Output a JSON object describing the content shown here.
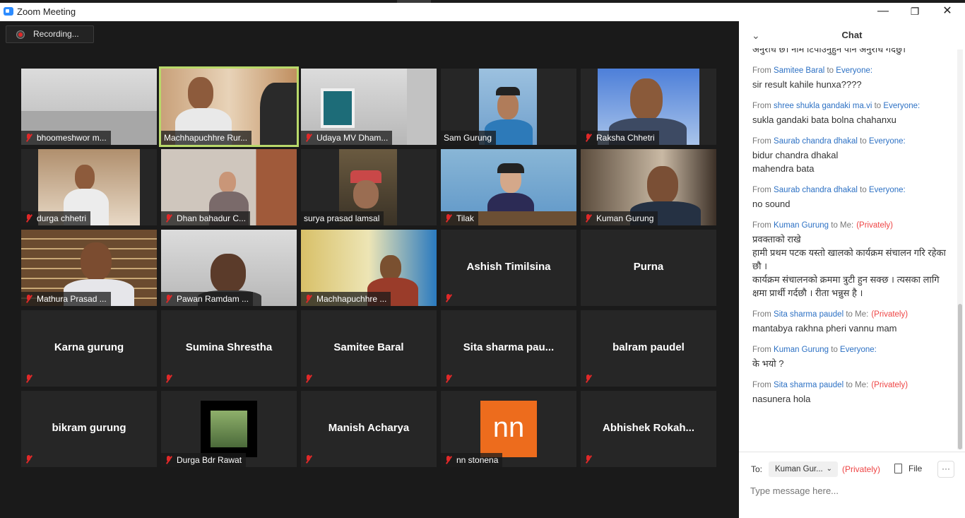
{
  "window": {
    "title": "Zoom Meeting",
    "controls": {
      "minimize": "—",
      "restore": "❐",
      "close": "✕"
    }
  },
  "meeting": {
    "recording_label": "Recording...",
    "tiles": [
      {
        "name": "bhoomeshwor m...",
        "type": "video"
      },
      {
        "name": "Machhapuchhre Rur...",
        "type": "video",
        "active": true
      },
      {
        "name": "Udaya MV Dham...",
        "type": "video"
      },
      {
        "name": "Sam Gurung",
        "type": "video"
      },
      {
        "name": "Raksha Chhetri",
        "type": "video"
      },
      {
        "name": "durga chhetri",
        "type": "video"
      },
      {
        "name": "Dhan bahadur C...",
        "type": "video"
      },
      {
        "name": "surya prasad lamsal",
        "type": "video"
      },
      {
        "name": "Tilak",
        "type": "video"
      },
      {
        "name": "Kuman Gurung",
        "type": "video"
      },
      {
        "name": "Mathura Prasad ...",
        "type": "video"
      },
      {
        "name": "Pawan Ramdam ...",
        "type": "video"
      },
      {
        "name": "Machhapuchhre ...",
        "type": "video"
      },
      {
        "name": "Ashish Timilsina",
        "type": "name"
      },
      {
        "name": "Purna",
        "type": "name"
      },
      {
        "name": "Karna gurung",
        "type": "name"
      },
      {
        "name": "Sumina Shrestha",
        "type": "name"
      },
      {
        "name": "Samitee Baral",
        "type": "name"
      },
      {
        "name": "Sita sharma pau...",
        "type": "name"
      },
      {
        "name": "balram paudel",
        "type": "name"
      },
      {
        "name": "bikram gurung",
        "type": "name"
      },
      {
        "name": "Durga Bdr Rawat",
        "type": "picture"
      },
      {
        "name": "Manish Acharya",
        "type": "name"
      },
      {
        "name": "nn stonena",
        "type": "initials",
        "initials": "nn"
      },
      {
        "name": "Abhishek  Rokah...",
        "type": "name"
      }
    ]
  },
  "chat": {
    "title": "Chat",
    "partial_text": "अनुरोध छ। नाम टिपाउनुहुन पनि अनुरोध गर्दछु।",
    "messages": [
      {
        "from": "Samitee Baral",
        "to": "Everyone:",
        "private": "",
        "text": "sir result kahile hunxa????"
      },
      {
        "from": "shree shukla gandaki ma.vi",
        "to": "Everyone:",
        "private": "",
        "text": "sukla gandaki bata bolna chahanxu"
      },
      {
        "from": "Saurab chandra dhakal",
        "to": "Everyone:",
        "private": "",
        "text": "bidur chandra dhakal\nmahendra bata"
      },
      {
        "from": "Saurab chandra dhakal",
        "to": "Everyone:",
        "private": "",
        "text": "no sound"
      },
      {
        "from": "Kuman Gurung",
        "to": "Me:",
        "private": "(Privately)",
        "text": "प्रवक्ताको राखे\nहामी प्रथम पटक यस्तो खालको कार्यक्रम संचालन गरि रहेका छौ ।\nकार्यक्रम संचालनको क्रममा त्रुटी हुन सक्छ । त्यसका लागि क्षमा प्रार्थी गर्दछौ । रीता भन्नुस है ।"
      },
      {
        "from": "Sita sharma paudel",
        "to": "Me:",
        "private": "(Privately)",
        "text": "mantabya rakhna pheri vannu mam"
      },
      {
        "from": "Kuman Gurung",
        "to": "Everyone:",
        "private": "",
        "text": "के भयो ?"
      },
      {
        "from": "Sita sharma paudel",
        "to": "Me:",
        "private": "(Privately)",
        "text": "nasunera hola"
      }
    ],
    "from_word": "From",
    "to_word": "to",
    "footer": {
      "to_label": "To:",
      "recipient": "Kuman Gur...",
      "private_label": "(Privately)",
      "file_label": "File",
      "more_label": "···",
      "input_placeholder": "Type message here..."
    }
  }
}
